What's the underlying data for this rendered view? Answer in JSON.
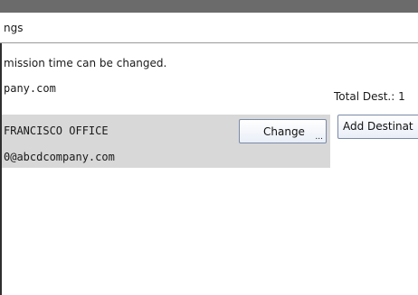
{
  "title": "ngs",
  "notice": "mission time can be changed.",
  "sender_email": "pany.com",
  "total_dest": "Total Dest.: 1",
  "destination": {
    "name": "FRANCISCO OFFICE",
    "email": "0@abcdcompany.com"
  },
  "buttons": {
    "change_label": "Change",
    "change_ellipsis": "...",
    "add_label": "Add Destinat"
  },
  "colors": {
    "topbar": "#6b6b6b",
    "panel": "#d8d8d8",
    "button_border": "#7a8aa8"
  }
}
